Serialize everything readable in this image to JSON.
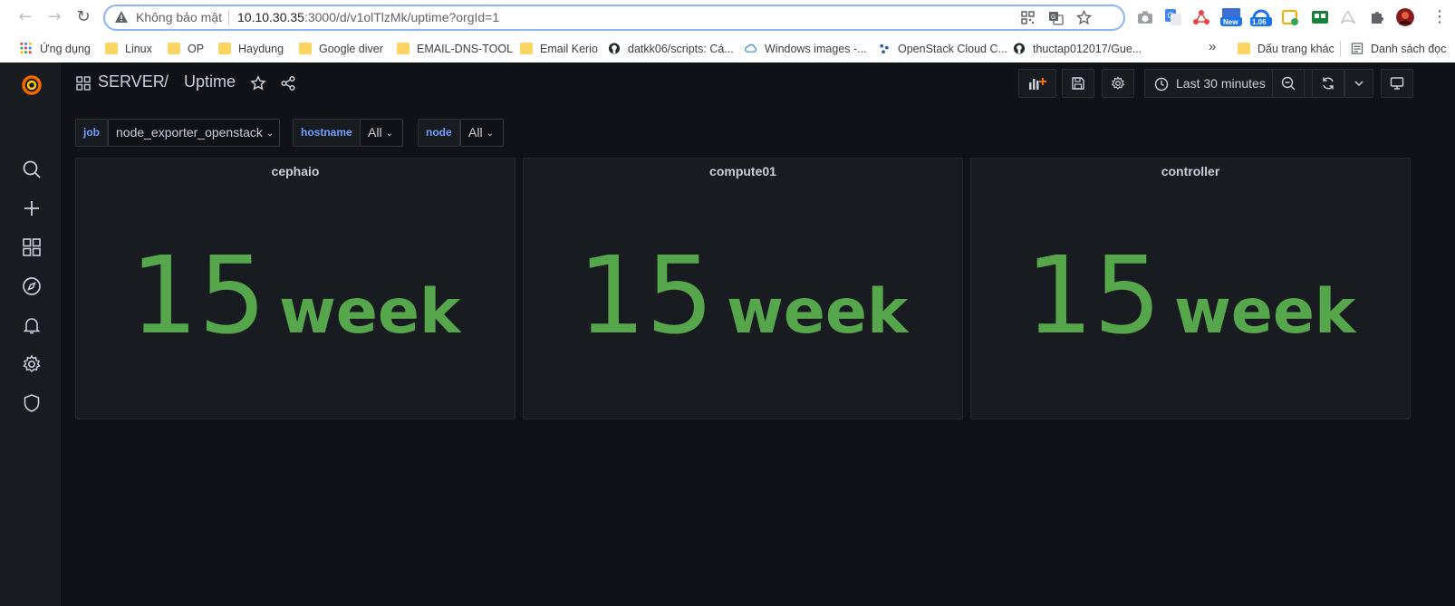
{
  "browser": {
    "security_label": "Không bảo mật",
    "url_host": "10.10.30.35",
    "url_rest": ":3000/d/v1olTlzMk/uptime?orgId=1",
    "extension_badges": [
      "New",
      "1.06"
    ],
    "bookmarks": [
      {
        "label": "Ứng dụng",
        "icon": "apps-grid-icon"
      },
      {
        "label": "Linux",
        "icon": "folder-icon"
      },
      {
        "label": "OP",
        "icon": "folder-icon"
      },
      {
        "label": "Haydung",
        "icon": "folder-icon"
      },
      {
        "label": "Google diver",
        "icon": "folder-icon"
      },
      {
        "label": "EMAIL-DNS-TOOL",
        "icon": "folder-icon"
      },
      {
        "label": "Email Kerio",
        "icon": "folder-icon"
      },
      {
        "label": "datkk06/scripts: Cá...",
        "icon": "github-icon"
      },
      {
        "label": "Windows images -...",
        "icon": "cloud-icon"
      },
      {
        "label": "OpenStack Cloud C...",
        "icon": "openstack-icon"
      },
      {
        "label": "thuctap012017/Gue...",
        "icon": "github-icon"
      }
    ],
    "overflow_label": "»",
    "other_bookmarks": "Dấu trang khác",
    "reading_list": "Danh sách đọc"
  },
  "dashboard": {
    "folder": "SERVER",
    "separator": "/",
    "title": "Uptime",
    "time_range": "Last 30 minutes",
    "variables": [
      {
        "label": "job",
        "value": "node_exporter_openstack"
      },
      {
        "label": "hostname",
        "value": "All"
      },
      {
        "label": "node",
        "value": "All"
      }
    ],
    "panels": [
      {
        "title": "cephaio",
        "value": "15",
        "unit": "week"
      },
      {
        "title": "compute01",
        "value": "15",
        "unit": "week"
      },
      {
        "title": "controller",
        "value": "15",
        "unit": "week"
      }
    ],
    "colors": {
      "stat": "#56a64b",
      "brand": "#f46800",
      "var_label": "#6e9fff"
    }
  }
}
